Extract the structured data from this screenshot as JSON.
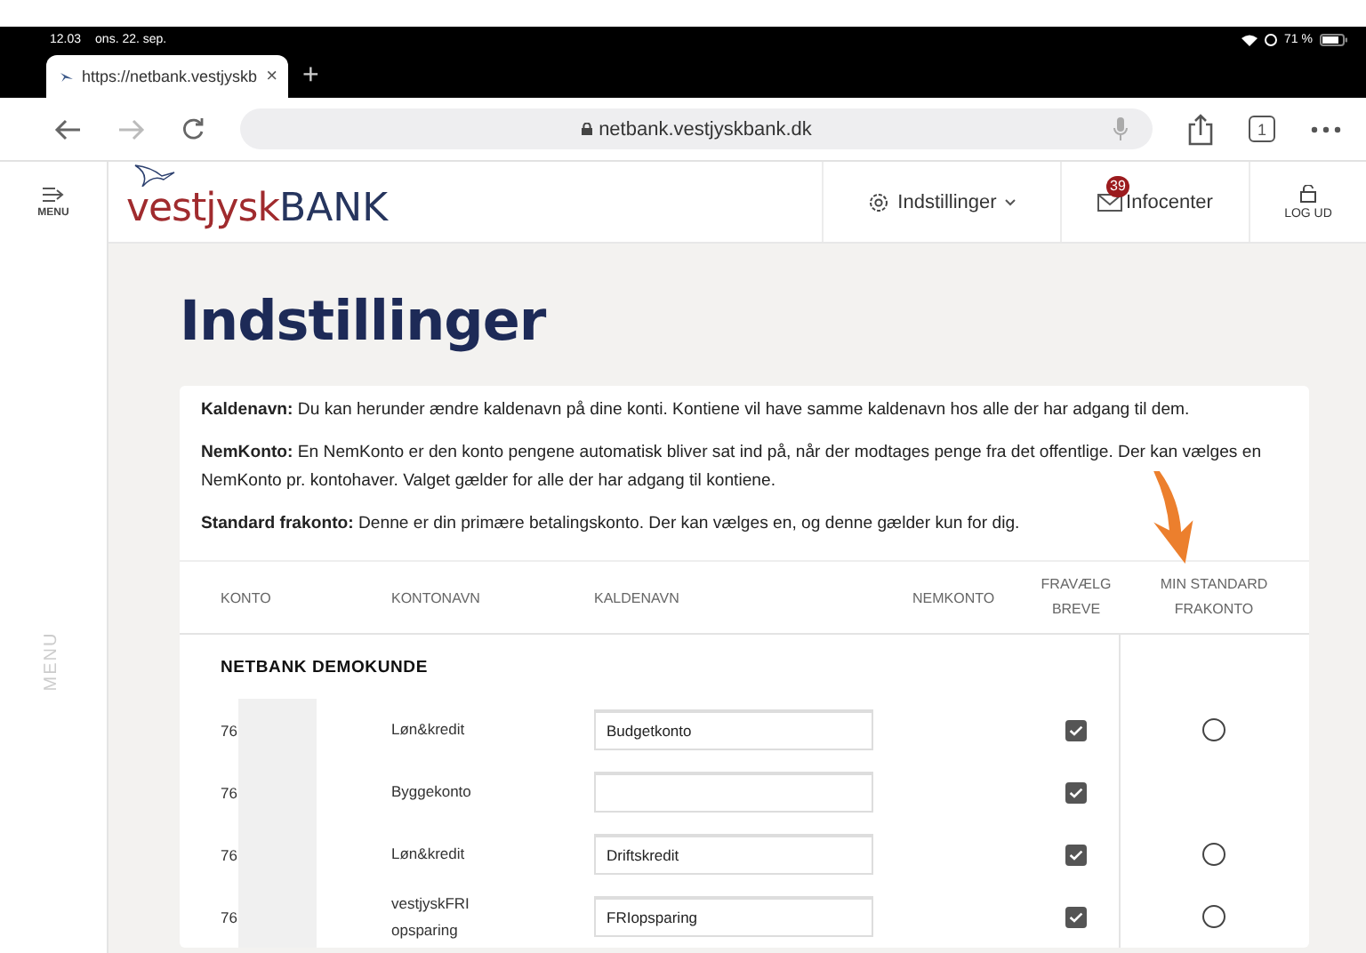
{
  "status_bar": {
    "time": "12.03",
    "date": "ons. 22. sep.",
    "battery": "71 %"
  },
  "browser": {
    "tab": {
      "title": "https://netbank.vestjyskb",
      "close": "×"
    },
    "new_tab": "+",
    "address": "netbank.vestjyskbank.dk",
    "tab_count": "1"
  },
  "header": {
    "menu_label": "MENU",
    "logo": {
      "part_1": "vestjysk",
      "part_2": "BANK"
    },
    "settings": "Indstillinger",
    "infocenter": "Infocenter",
    "infocenter_badge": "39",
    "logout": "LOG UD"
  },
  "side_menu_label": "MENU",
  "page_title": "Indstillinger",
  "info": [
    {
      "term": "Kaldenavn:",
      "text": "Du kan herunder ændre kaldenavn på dine konti. Kontiene vil have samme kaldenavn hos alle der har adgang til dem."
    },
    {
      "term": "NemKonto:",
      "text": "En NemKonto er den konto pengene automatisk bliver sat ind på, når der modtages penge fra det offentlige. Der kan vælges en NemKonto pr. kontohaver. Valget gælder for alle der har adgang til kontiene."
    },
    {
      "term": "Standard frakonto:",
      "text": "Denne er din primære betalingskonto. Der kan vælges en, og denne gælder kun for dig."
    }
  ],
  "table": {
    "columns": [
      "KONTO",
      "KONTONAVN",
      "KALDENAVN",
      "NEMKONTO",
      "FRAVÆLG BREVE",
      "MIN STANDARD FRAKONTO"
    ],
    "group": "NETBANK DEMOKUNDE",
    "rows": [
      {
        "account": "76",
        "account_name": "Løn&kredit",
        "nickname": "Budgetkonto",
        "opt_out_letters": true,
        "standard_frakonto": {
          "selected": false
        }
      },
      {
        "account": "76",
        "account_name": "Byggekonto",
        "opt_out_letters": true
      },
      {
        "account": "76",
        "account_name": "Løn&kredit",
        "nickname": "Driftskredit",
        "opt_out_letters": true,
        "standard_frakonto": {
          "selected": false
        }
      },
      {
        "account": "76",
        "account_name": "vestjyskFRI opsparing",
        "nickname": "FRIopsparing",
        "opt_out_letters": true,
        "standard_frakonto": {
          "selected": false
        }
      }
    ]
  }
}
